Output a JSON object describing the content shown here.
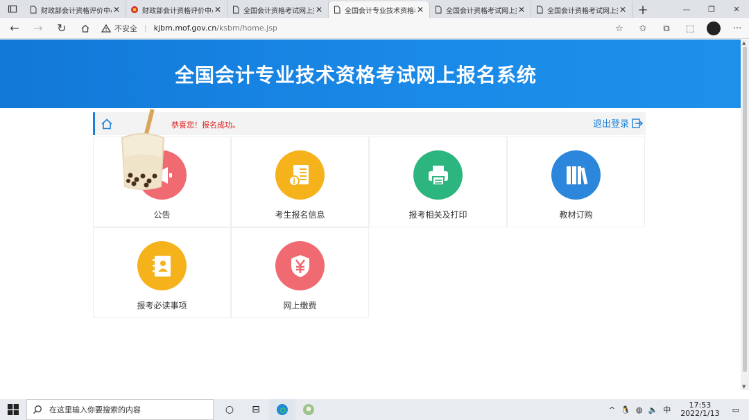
{
  "browser": {
    "tabs": [
      {
        "title": "财政部会计资格评价中心",
        "active": false
      },
      {
        "title": "财政部会计资格评价中心",
        "active": false
      },
      {
        "title": "全国会计资格考试网上报名",
        "active": false
      },
      {
        "title": "全国会计专业技术资格考试",
        "active": true
      },
      {
        "title": "全国会计资格考试网上报名",
        "active": false
      },
      {
        "title": "全国会计资格考试网上报名",
        "active": false
      }
    ],
    "security_label": "不安全",
    "url_host": "kjbm.mof.gov.cn",
    "url_path": "/ksbm/home.jsp"
  },
  "page": {
    "banner_title": "全国会计专业技术资格考试网上报名系统",
    "success_message": "恭喜您！报名成功。",
    "logout_label": "退出登录",
    "menu": [
      {
        "label": "公告",
        "color": "#f06a72",
        "icon": "megaphone-icon"
      },
      {
        "label": "考生报名信息",
        "color": "#f5b21b",
        "icon": "info-document-icon"
      },
      {
        "label": "报考相关及打印",
        "color": "#2cb57e",
        "icon": "printer-icon"
      },
      {
        "label": "教材订购",
        "color": "#2b86dc",
        "icon": "books-icon"
      },
      {
        "label": "报考必读事项",
        "color": "#f5b21b",
        "icon": "contact-book-icon"
      },
      {
        "label": "网上缴费",
        "color": "#f06a72",
        "icon": "yen-shield-icon"
      }
    ]
  },
  "taskbar": {
    "search_placeholder": "在这里输入你要搜索的内容",
    "ime_label": "中",
    "time": "17:53",
    "date": "2022/1/13"
  }
}
